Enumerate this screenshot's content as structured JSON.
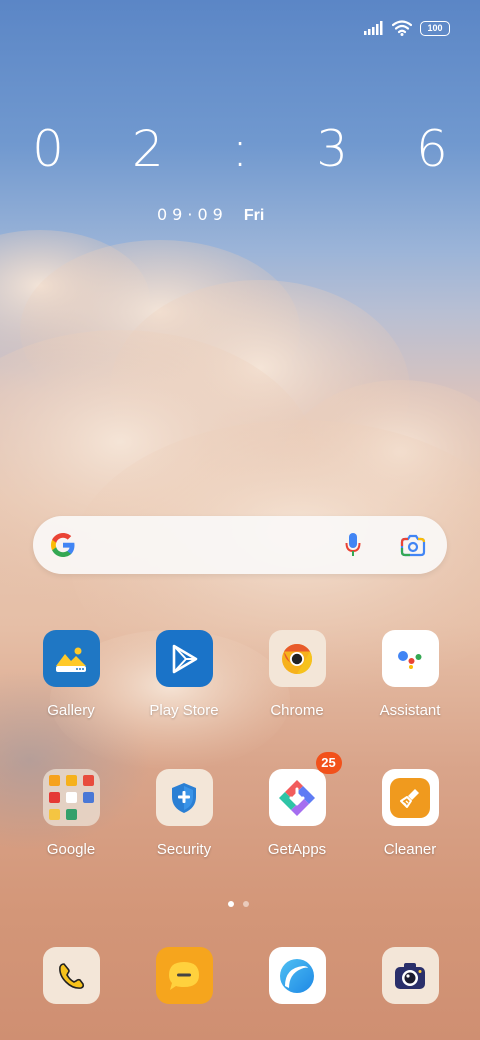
{
  "status_bar": {
    "battery": "100",
    "signal_icon": "cellular-signal-icon",
    "wifi_icon": "wifi-icon"
  },
  "clock": {
    "time": "0 2 : 3 6",
    "date": "09·09",
    "day": "Fri"
  },
  "search_bar": {
    "logo_icon": "google-g-icon",
    "mic_icon": "microphone-icon",
    "lens_icon": "google-lens-icon"
  },
  "apps_row1": [
    {
      "label": "Gallery",
      "icon": "gallery-icon"
    },
    {
      "label": "Play Store",
      "icon": "play-store-icon"
    },
    {
      "label": "Chrome",
      "icon": "chrome-icon"
    },
    {
      "label": "Assistant",
      "icon": "assistant-icon"
    }
  ],
  "apps_row2": [
    {
      "label": "Google",
      "icon": "google-folder-icon"
    },
    {
      "label": "Security",
      "icon": "security-shield-icon"
    },
    {
      "label": "GetApps",
      "icon": "getapps-icon",
      "badge": "25"
    },
    {
      "label": "Cleaner",
      "icon": "cleaner-brush-icon"
    }
  ],
  "page_indicator": {
    "pages": 2,
    "current": 1
  },
  "dock": [
    {
      "icon": "phone-icon"
    },
    {
      "icon": "messages-icon"
    },
    {
      "icon": "browser-icon"
    },
    {
      "icon": "camera-icon"
    }
  ],
  "colors": {
    "sky_top": "#5b86c6",
    "cloud": "#e7c6b1",
    "badge": "#f2511b",
    "gallery_blue": "#1f77c4",
    "play_blue": "#1a73c8"
  }
}
